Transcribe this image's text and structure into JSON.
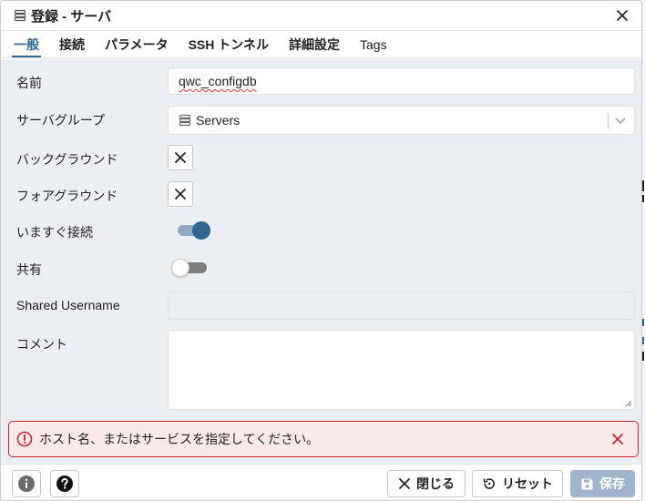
{
  "dialog": {
    "title": "登録 - サーバ",
    "title_icon": "server-group-icon",
    "close_icon": "close-icon"
  },
  "tabs": [
    {
      "label": "一般",
      "active": true
    },
    {
      "label": "接続",
      "active": false
    },
    {
      "label": "パラメータ",
      "active": false
    },
    {
      "label": "SSH トンネル",
      "active": false
    },
    {
      "label": "詳細設定",
      "active": false
    },
    {
      "label": "Tags",
      "active": false
    }
  ],
  "form": {
    "name": {
      "label": "名前",
      "value": "qwc_configdb"
    },
    "server_group": {
      "label": "サーバグループ",
      "value": "Servers",
      "icon": "server-group-icon"
    },
    "background": {
      "label": "バックグラウンド",
      "icon": "clear-icon"
    },
    "foreground": {
      "label": "フォアグラウンド",
      "icon": "clear-icon"
    },
    "connect_now": {
      "label": "いますぐ接続",
      "state": true
    },
    "shared": {
      "label": "共有",
      "state": false
    },
    "shared_username": {
      "label": "Shared Username",
      "value": ""
    },
    "comment": {
      "label": "コメント",
      "value": ""
    }
  },
  "error": {
    "message": "ホスト名、またはサービスを指定してください。",
    "icon": "error-circle-icon",
    "close_icon": "close-icon"
  },
  "footer": {
    "info_icon": "info-icon",
    "help_icon": "help-icon",
    "close_label": "閉じる",
    "reset_label": "リセット",
    "save_label": "保存"
  },
  "colors": {
    "accent": "#326690",
    "error_border": "#c5242f",
    "error_bg": "#fbe9ea",
    "save_disabled": "#9fb5cc"
  }
}
